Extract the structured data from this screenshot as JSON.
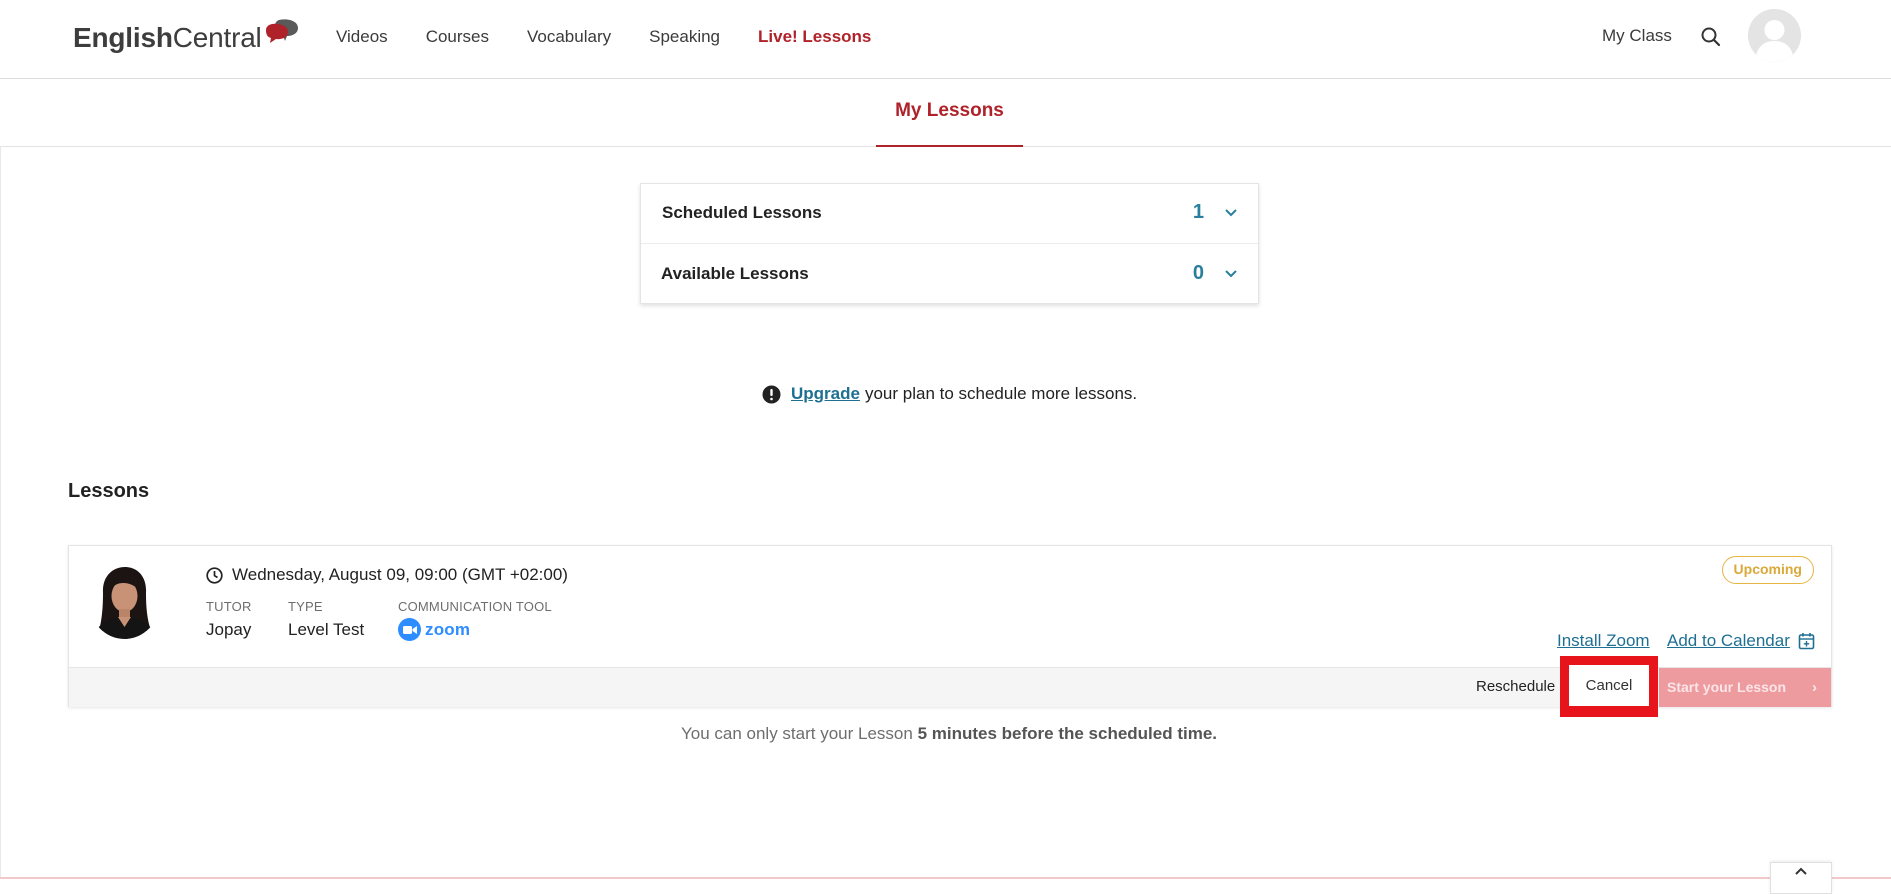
{
  "header": {
    "logo_part1": "English",
    "logo_part2": "Central",
    "nav": [
      "Videos",
      "Courses",
      "Vocabulary",
      "Speaking",
      "Live! Lessons"
    ],
    "my_class": "My Class"
  },
  "tabs": {
    "active": "My Lessons"
  },
  "summary": {
    "scheduled_label": "Scheduled Lessons",
    "scheduled_count": "1",
    "available_label": "Available Lessons",
    "available_count": "0"
  },
  "notice": {
    "link": "Upgrade",
    "text": "your plan to schedule more lessons."
  },
  "lessons": {
    "heading": "Lessons",
    "card": {
      "datetime": "Wednesday, August 09, 09:00 (GMT +02:00)",
      "tutor_label": "TUTOR",
      "tutor": "Jopay",
      "type_label": "TYPE",
      "type": "Level Test",
      "tool_label": "COMMUNICATION TOOL",
      "tool": "zoom",
      "status": "Upcoming",
      "install_zoom": "Install Zoom",
      "add_to_calendar": "Add to Calendar",
      "reschedule": "Reschedule",
      "cancel": "Cancel",
      "start": "Start your Lesson"
    },
    "footnote_prefix": "You can only start your Lesson",
    "footnote_bold": "5 minutes before the scheduled time."
  },
  "colors": {
    "brand_red": "#b0222a",
    "link_teal": "#1f6f93",
    "count_teal": "#2a7f9e",
    "badge_amber": "#d9a93a",
    "zoom_blue": "#2d8cff",
    "highlight_red": "#e8141c"
  },
  "icons": [
    "chat-bubbles-logo-icon",
    "search-icon",
    "user-avatar-icon",
    "chevron-down-icon",
    "alert-circle-icon",
    "clock-icon",
    "zoom-camera-icon",
    "calendar-add-icon",
    "chevron-right-icon",
    "chevron-up-icon"
  ]
}
